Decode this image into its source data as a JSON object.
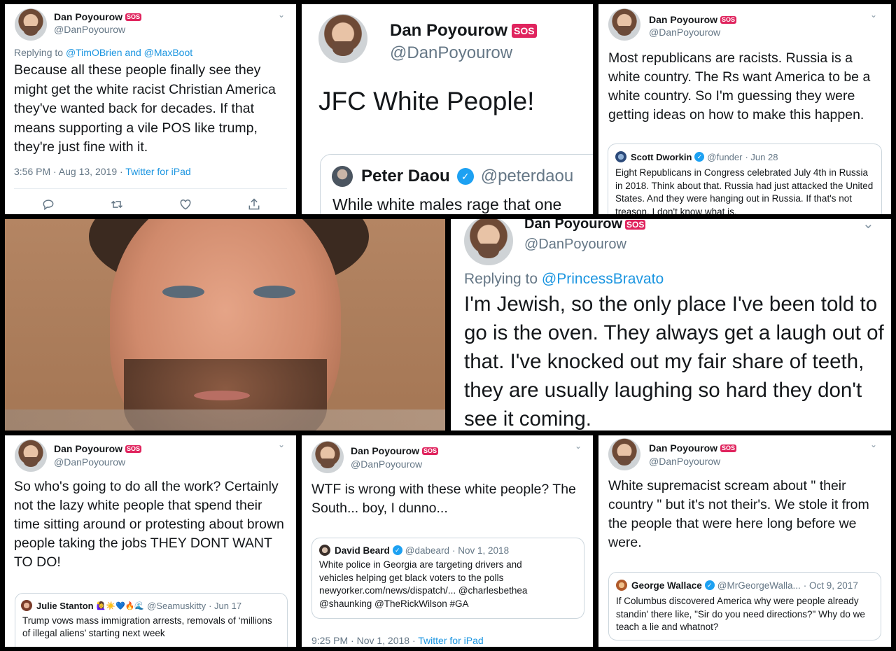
{
  "colors": {
    "link": "#1b95e0",
    "verified": "#1da1f2",
    "sos": "#e0245e"
  },
  "icons": {
    "chevron": "chevron-down-icon",
    "reply": "reply-icon",
    "retweet": "retweet-icon",
    "like": "heart-icon",
    "share": "share-icon",
    "verified": "verified-badge-icon"
  },
  "t1": {
    "name": "Dan Poyourow",
    "sos": "SOS",
    "handle": "@DanPoyourow",
    "replying_prefix": "Replying to",
    "reply_to_1": "@TimOBrien",
    "and": "and",
    "reply_to_2": "@MaxBoot",
    "text": "Because all these people finally see they might get the white  racist Christian America they've wanted back for decades. If that means supporting a vile POS like trump, they're just fine with it.",
    "time": "3:56 PM · Aug 13, 2019 ·",
    "source": "Twitter for iPad"
  },
  "t2": {
    "name": "Dan Poyourow",
    "sos": "SOS",
    "handle": "@DanPoyourow",
    "text": "JFC White People!",
    "quote": {
      "name": "Peter Daou",
      "handle": "@peterdaou",
      "text": "While white males rage that one"
    }
  },
  "t3": {
    "name": "Dan Poyourow",
    "sos": "SOS",
    "handle": "@DanPoyourow",
    "text": "Most republicans are racists. Russia is a white country. The Rs want America to be a white country. So I'm guessing they were getting ideas on how to make this happen.",
    "quote": {
      "name": "Scott Dworkin",
      "handle": "@funder",
      "date": "· Jun 28",
      "text": "Eight Republicans in Congress celebrated July 4th in Russia in 2018. Think about that. Russia had just attacked the United States. And they were hanging out in Russia. If that's not treason, I don't know what is."
    }
  },
  "t4": {
    "name": "Dan Poyourow",
    "sos": "SOS",
    "handle": "@DanPoyourow",
    "replying_prefix": "Replying to",
    "reply_to": "@PrincessBravato",
    "text": "I'm Jewish, so the only place I've been told to go is the oven. They always get a laugh out of that. I've knocked out my fair share of teeth, they are usually laughing so hard they don't see it coming."
  },
  "t5": {
    "name": "Dan Poyourow",
    "sos": "SOS",
    "handle": "@DanPoyourow",
    "text": "So who's going to do all the work? Certainly not the lazy white people that spend their time sitting around or protesting about brown people taking the jobs THEY DONT WANT TO DO!",
    "quote": {
      "name": "Julie Stanton",
      "emoji": "🙋‍♀️☀️💙🔥🌊",
      "handle": "@Seamuskitty",
      "date": "· Jun 17",
      "text": "Trump vows mass immigration arrests, removals of ‘millions of illegal aliens’ starting next week"
    }
  },
  "t6": {
    "name": "Dan Poyourow",
    "sos": "SOS",
    "handle": "@DanPoyourow",
    "text": "WTF is wrong with these white people? The South... boy, I dunno...",
    "quote": {
      "name": "David Beard",
      "handle": "@dabeard",
      "date": "· Nov 1, 2018",
      "line1": "White police in Georgia are targeting drivers and",
      "line2": "vehicles helping get black voters to the polls",
      "line3": "newyorker.com/news/dispatch/... @charlesbethea",
      "line4": "@shaunking @TheRickWilson #GA"
    },
    "time": "9:25 PM · Nov 1, 2018 ·",
    "source": "Twitter for iPad"
  },
  "t7": {
    "name": "Dan Poyourow",
    "sos": "SOS",
    "handle": "@DanPoyourow",
    "text": "White supremacist scream about \" their country \" but it's not their's. We stole it from the people that were here long before we were.",
    "quote": {
      "name": "George Wallace",
      "handle": "@MrGeorgeWalla...",
      "date": "· Oct 9, 2017",
      "text": "If Columbus discovered America why were people already standin' there like, \"Sir do you need directions?\" Why do we teach a lie and whatnot?"
    }
  }
}
